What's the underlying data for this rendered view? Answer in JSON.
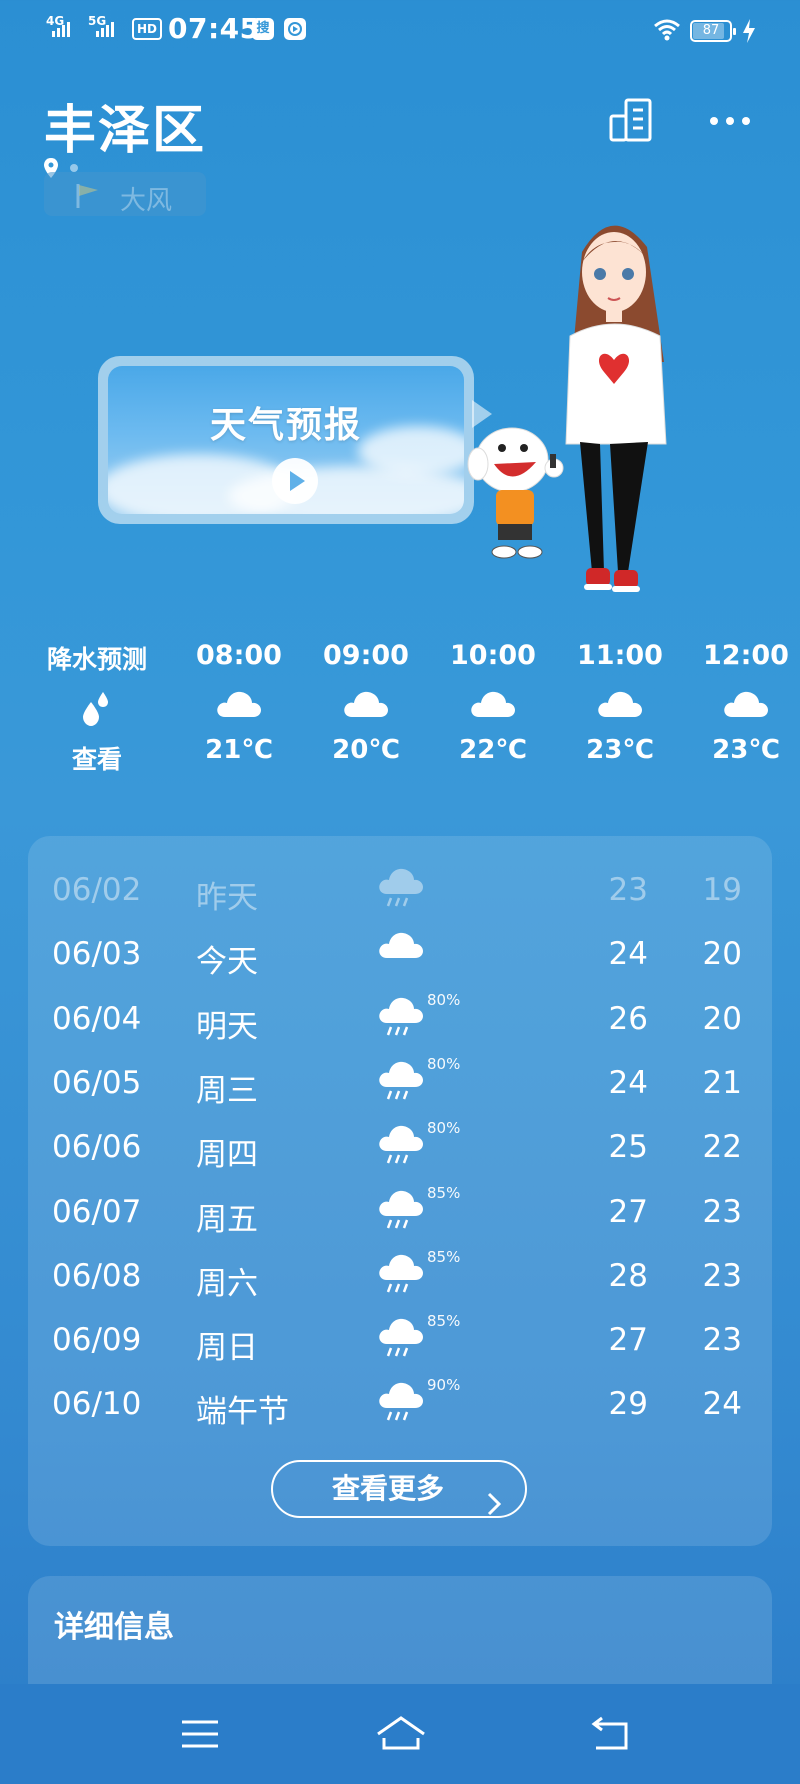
{
  "status_bar": {
    "sim1": "4G",
    "sim2": "5G",
    "hd": "HD",
    "time": "07:45",
    "app_icon_1": "搜",
    "battery": "87",
    "battery_level": 0.87
  },
  "header": {
    "city": "丰泽区",
    "alert": "大风",
    "icons": [
      "location-pin-icon",
      "city-building-icon",
      "more-dots-icon"
    ]
  },
  "forecast_bubble": {
    "title": "天气预报"
  },
  "hourly": {
    "precip_label": "降水预测",
    "precip_action": "查看",
    "items": [
      {
        "time": "08:00",
        "temp": "21℃",
        "icon": "cloudy-icon"
      },
      {
        "time": "09:00",
        "temp": "20℃",
        "icon": "cloudy-icon"
      },
      {
        "time": "10:00",
        "temp": "22℃",
        "icon": "cloudy-icon"
      },
      {
        "time": "11:00",
        "temp": "23℃",
        "icon": "cloudy-icon"
      },
      {
        "time": "12:00",
        "temp": "23℃",
        "icon": "cloudy-icon"
      }
    ]
  },
  "daily": {
    "items": [
      {
        "date": "06/02",
        "name": "昨天",
        "icon": "rain-icon",
        "pop": "",
        "high": "23",
        "low": "19",
        "past": true
      },
      {
        "date": "06/03",
        "name": "今天",
        "icon": "cloudy-icon",
        "pop": "",
        "high": "24",
        "low": "20",
        "past": false
      },
      {
        "date": "06/04",
        "name": "明天",
        "icon": "rain-icon",
        "pop": "80%",
        "high": "26",
        "low": "20",
        "past": false
      },
      {
        "date": "06/05",
        "name": "周三",
        "icon": "rain-icon",
        "pop": "80%",
        "high": "24",
        "low": "21",
        "past": false
      },
      {
        "date": "06/06",
        "name": "周四",
        "icon": "rain-icon",
        "pop": "80%",
        "high": "25",
        "low": "22",
        "past": false
      },
      {
        "date": "06/07",
        "name": "周五",
        "icon": "rain-icon",
        "pop": "85%",
        "high": "27",
        "low": "23",
        "past": false
      },
      {
        "date": "06/08",
        "name": "周六",
        "icon": "rain-icon",
        "pop": "85%",
        "high": "28",
        "low": "23",
        "past": false
      },
      {
        "date": "06/09",
        "name": "周日",
        "icon": "rain-icon",
        "pop": "85%",
        "high": "27",
        "low": "23",
        "past": false
      },
      {
        "date": "06/10",
        "name": "端午节",
        "icon": "rain-icon",
        "pop": "90%",
        "high": "29",
        "low": "24",
        "past": false
      }
    ],
    "more_label": "查看更多"
  },
  "detail": {
    "title": "详细信息"
  },
  "nav": [
    "menu-icon",
    "home-icon",
    "back-icon"
  ]
}
